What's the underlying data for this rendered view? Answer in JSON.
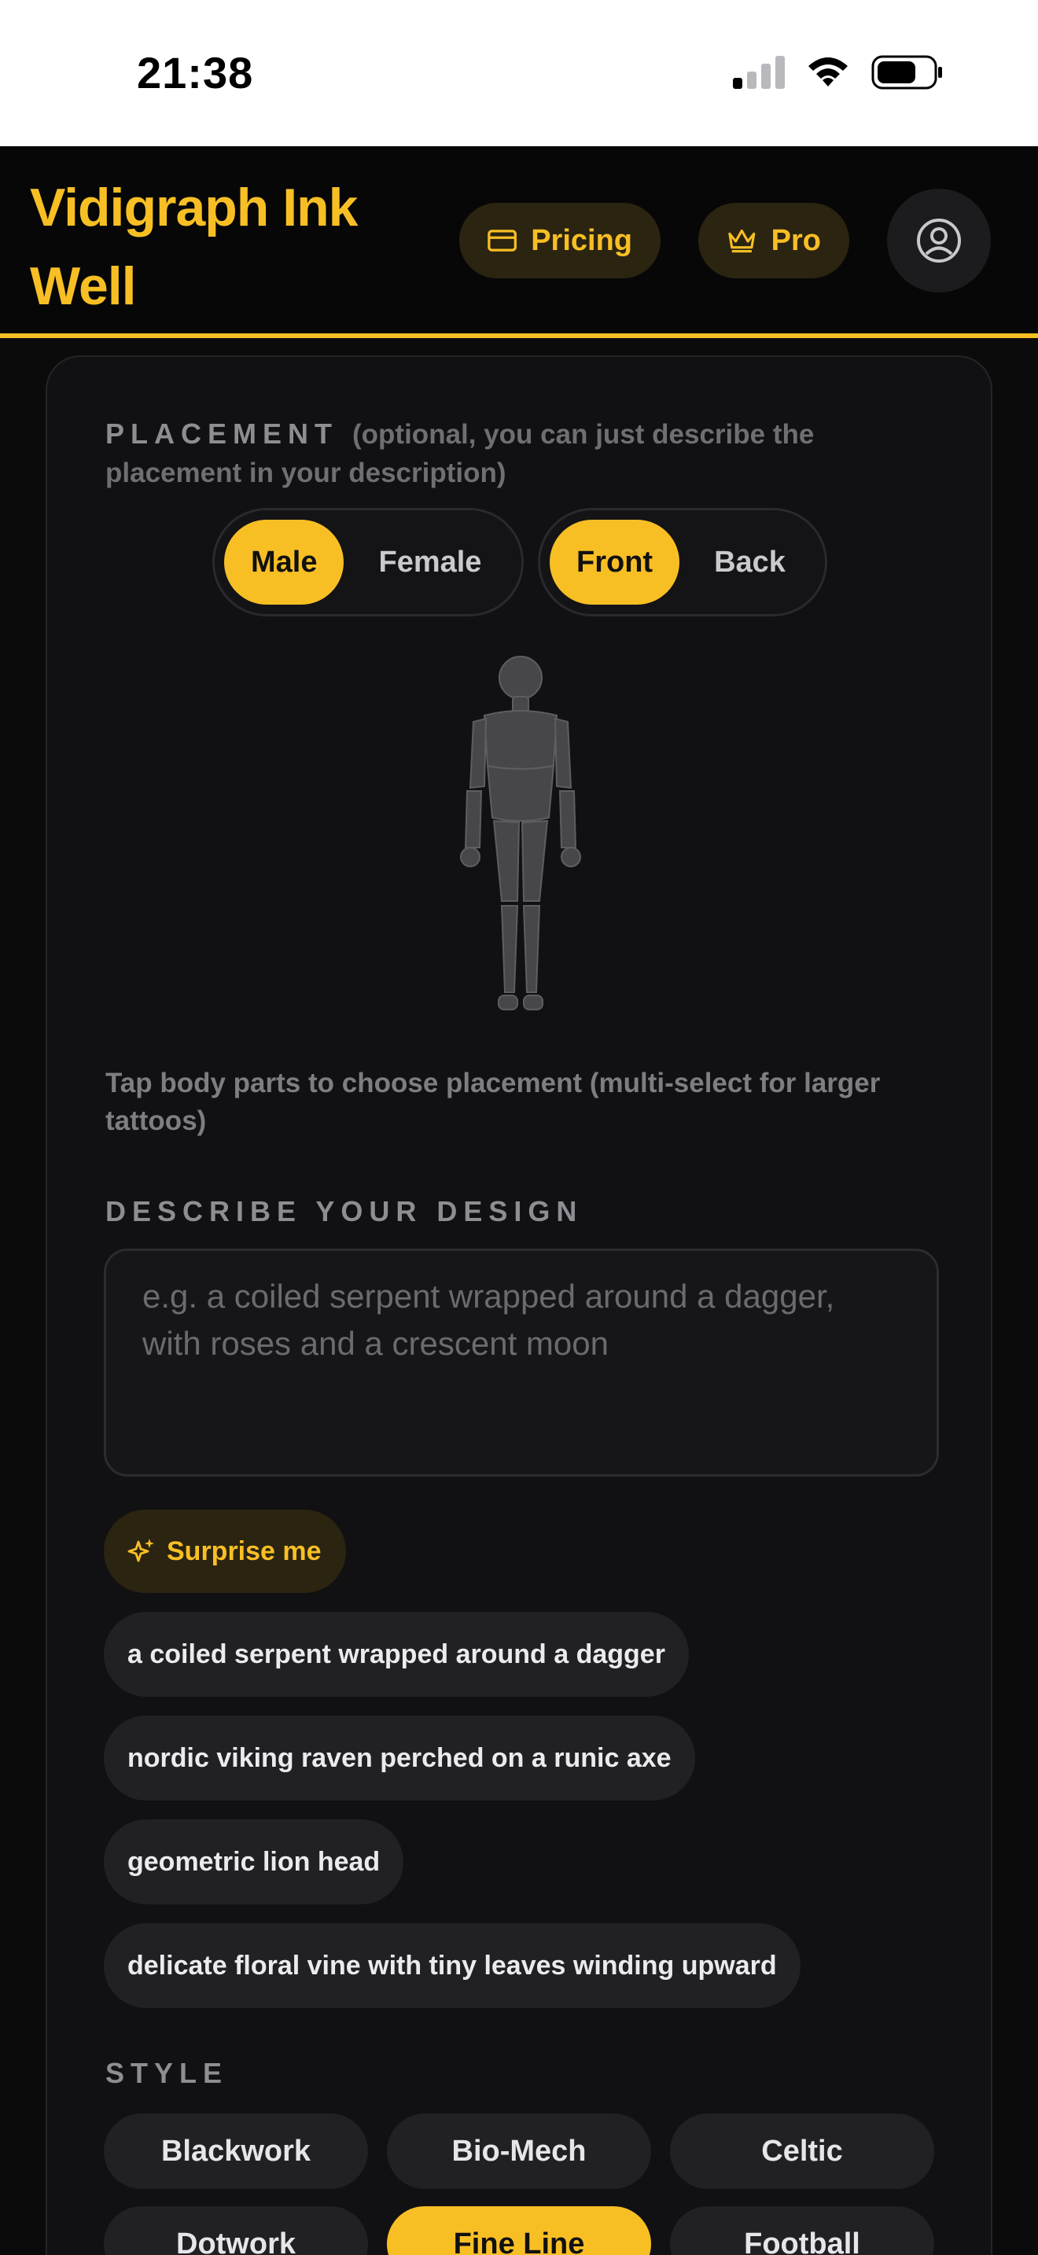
{
  "status_bar": {
    "time": "21:38"
  },
  "header": {
    "brand": "Vidigraph Ink Well",
    "pricing_label": "Pricing",
    "pro_label": "Pro"
  },
  "placement": {
    "label": "PLACEMENT",
    "note": "(optional, you can just describe the placement in your description)",
    "gender_options": [
      "Male",
      "Female"
    ],
    "gender_selected": "Male",
    "side_options": [
      "Front",
      "Back"
    ],
    "side_selected": "Front",
    "hint": "Tap body parts to choose placement (multi-select for larger tattoos)"
  },
  "design": {
    "label": "DESCRIBE YOUR DESIGN",
    "placeholder": "e.g. a coiled serpent wrapped around a dagger, with roses and a crescent moon",
    "value": "",
    "surprise_label": "Surprise me",
    "suggestions": [
      "a coiled serpent wrapped around a dagger",
      "nordic viking raven perched on a runic axe",
      "geometric lion head",
      "delicate floral vine with tiny leaves winding upward"
    ]
  },
  "style": {
    "label": "STYLE",
    "options": [
      "Blackwork",
      "Bio-Mech",
      "Celtic",
      "Dotwork",
      "Fine Line",
      "Football"
    ],
    "selected": "Fine Line"
  },
  "colors": {
    "accent": "#f8bf25",
    "background": "#0b0b0c",
    "card": "#111113",
    "chip": "#212124"
  },
  "icons": {
    "pricing": "credit-card-icon",
    "pro": "crown-icon",
    "account": "user-circle-icon",
    "surprise": "sparkles-icon"
  }
}
